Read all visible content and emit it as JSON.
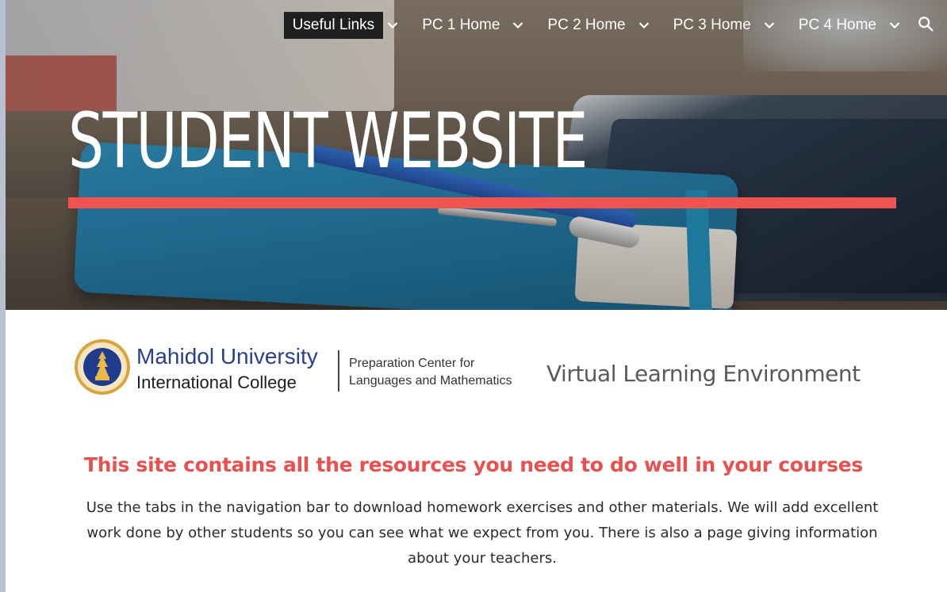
{
  "nav": {
    "items": [
      {
        "label": "Useful Links",
        "active": true
      },
      {
        "label": "PC 1 Home",
        "active": false
      },
      {
        "label": "PC 2 Home",
        "active": false
      },
      {
        "label": "PC 3 Home",
        "active": false
      },
      {
        "label": "PC 4 Home",
        "active": false
      }
    ],
    "search_icon": "search-icon",
    "dropdown_icon": "chevron-down-icon"
  },
  "hero": {
    "title": "STUDENT WEBSITE",
    "accent_color": "#f05350"
  },
  "logo": {
    "university": "Mahidol  University",
    "college": "International College",
    "center_line1": "Preparation Center for",
    "center_line2": "Languages and Mathematics",
    "vle": "Virtual Learning Environment"
  },
  "content": {
    "headline": "This site contains all the resources you need to do well in your courses",
    "body": "Use the tabs in the navigation bar to download homework exercises and other materials. We will add excellent work done by other students so you can see what we expect from you. There is also a page giving information about your teachers.",
    "headline_color": "#e8514f"
  }
}
